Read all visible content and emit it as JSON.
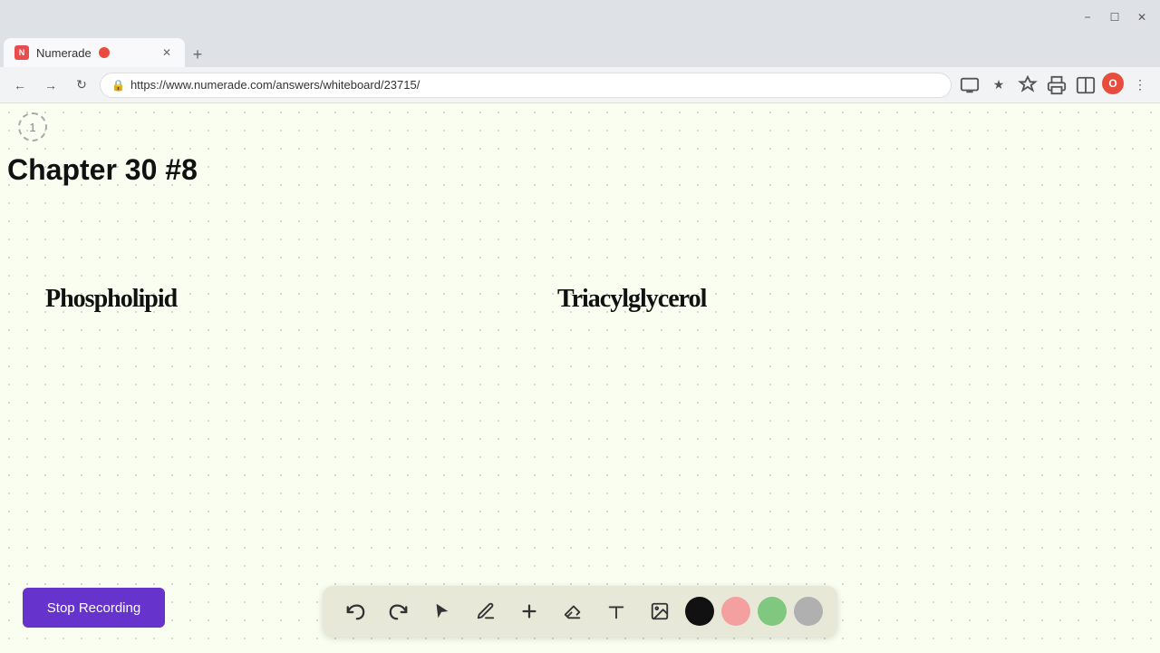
{
  "browser": {
    "tab_title": "Numerade",
    "tab_url": "https://www.numerade.com/answers/whiteboard/23715/",
    "favicon_color": "#e84c4c",
    "recording_dot": true,
    "new_tab_label": "+"
  },
  "nav": {
    "back": "←",
    "forward": "→",
    "refresh": "↻",
    "address": "https://www.numerade.com/answers/whiteboard/23715/",
    "lock_icon": "🔒"
  },
  "whiteboard": {
    "page_number": "1",
    "chapter_title": "Chapter 30 #8",
    "label1": "Phospholipid",
    "label2": "Triacylglycerol"
  },
  "toolbar": {
    "stop_recording_label": "Stop Recording",
    "undo_label": "undo",
    "redo_label": "redo",
    "select_label": "select",
    "pen_label": "pen",
    "add_label": "add",
    "eraser_label": "eraser",
    "text_label": "text",
    "image_label": "image",
    "colors": [
      "black",
      "pink",
      "green",
      "gray"
    ]
  }
}
